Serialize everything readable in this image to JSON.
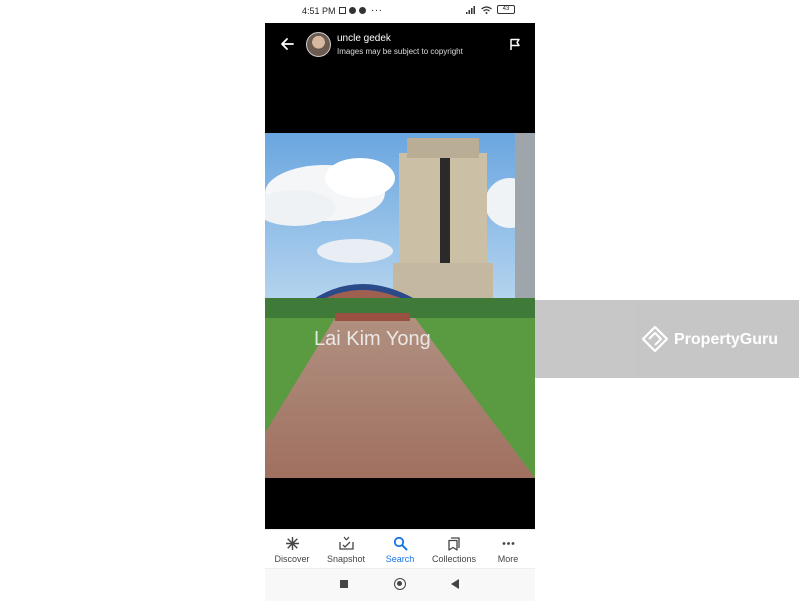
{
  "status_bar": {
    "time": "4:51 PM",
    "more_dots": "···",
    "battery": "43"
  },
  "header": {
    "username": "uncle gedek",
    "subtitle": "Images may be subject to copyright",
    "back_icon": "arrow-left-icon",
    "flag_icon": "flag-icon"
  },
  "image": {
    "watermark_text": "Lai Kim Yong"
  },
  "bottom_nav": {
    "items": [
      {
        "label": "Discover",
        "icon": "asterisk-icon"
      },
      {
        "label": "Snapshot",
        "icon": "snapshot-icon"
      },
      {
        "label": "Search",
        "icon": "search-icon"
      },
      {
        "label": "Collections",
        "icon": "collections-icon"
      },
      {
        "label": "More",
        "icon": "more-icon"
      }
    ],
    "active_color": "#1a73e8"
  },
  "watermark_banner": {
    "brand": "PropertyGuru"
  }
}
